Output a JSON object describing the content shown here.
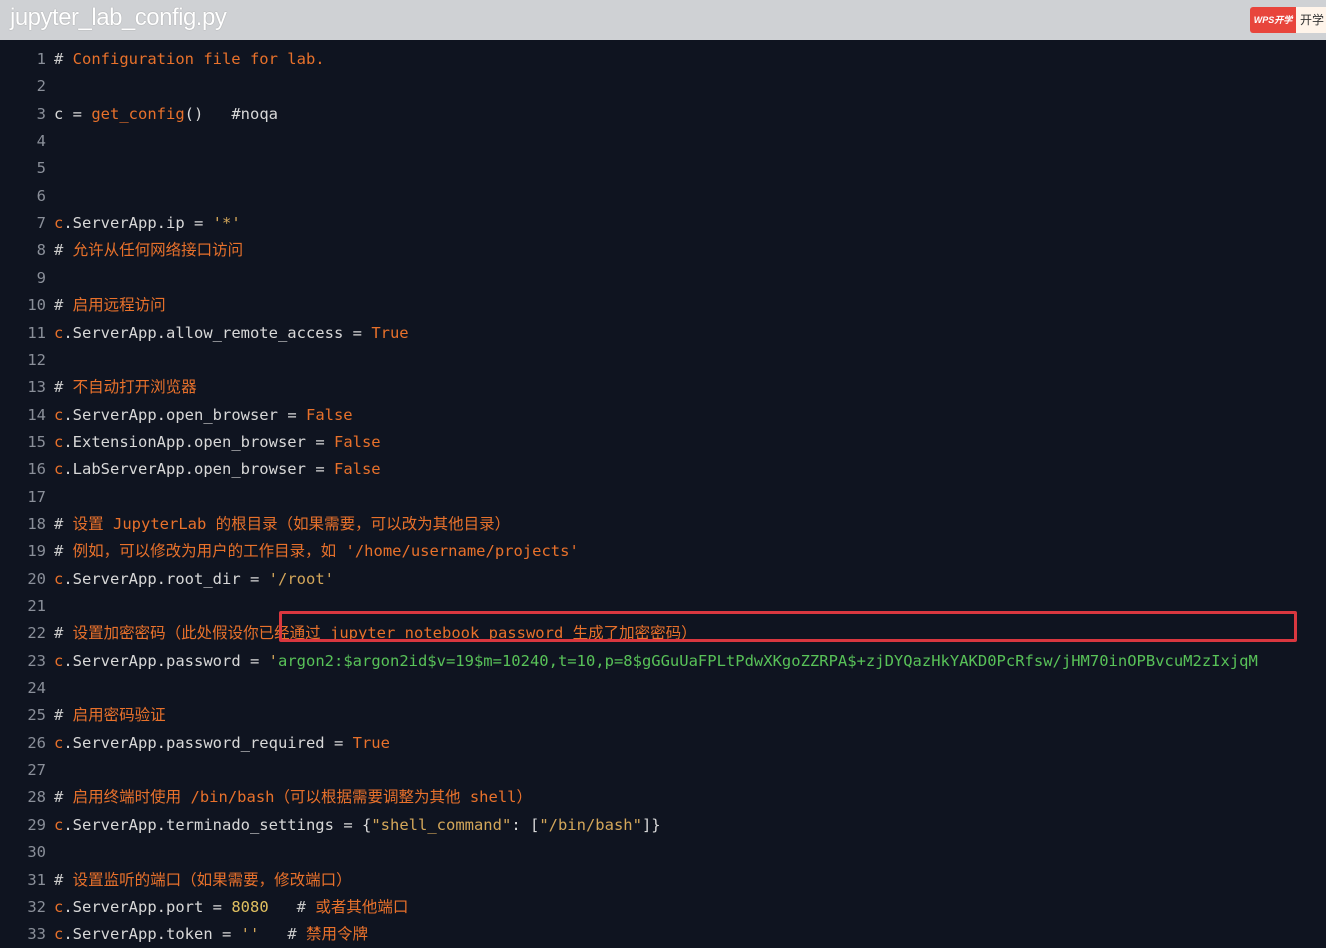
{
  "window": {
    "title": "jupyter_lab_config.py"
  },
  "wps": {
    "badge": "WPS开学季",
    "tab": "开学"
  },
  "lines": [
    {
      "n": "1",
      "parts": [
        [
          "c-hash",
          "# "
        ],
        [
          "c-cmt",
          "Configuration file for lab."
        ]
      ]
    },
    {
      "n": "2",
      "parts": []
    },
    {
      "n": "3",
      "parts": [
        [
          "c-txt",
          "c "
        ],
        [
          "c-op",
          "= "
        ],
        [
          "c-fn",
          "get_config"
        ],
        [
          "c-txt",
          "()   "
        ],
        [
          "c-txt",
          "#noqa"
        ]
      ]
    },
    {
      "n": "4",
      "parts": []
    },
    {
      "n": "5",
      "parts": []
    },
    {
      "n": "6",
      "parts": []
    },
    {
      "n": "7",
      "parts": [
        [
          "c-var",
          "c"
        ],
        [
          "c-txt",
          ".ServerApp.ip "
        ],
        [
          "c-op",
          "= "
        ],
        [
          "c-str",
          "'*'"
        ]
      ]
    },
    {
      "n": "8",
      "parts": [
        [
          "c-hash",
          "# "
        ],
        [
          "c-cmt",
          "允许从任何网络接口访问"
        ]
      ]
    },
    {
      "n": "9",
      "parts": []
    },
    {
      "n": "10",
      "parts": [
        [
          "c-hash",
          "# "
        ],
        [
          "c-cmt",
          "启用远程访问"
        ]
      ]
    },
    {
      "n": "11",
      "parts": [
        [
          "c-var",
          "c"
        ],
        [
          "c-txt",
          ".ServerApp.allow_remote_access "
        ],
        [
          "c-op",
          "= "
        ],
        [
          "c-kw",
          "True"
        ]
      ]
    },
    {
      "n": "12",
      "parts": []
    },
    {
      "n": "13",
      "parts": [
        [
          "c-hash",
          "# "
        ],
        [
          "c-cmt",
          "不自动打开浏览器"
        ]
      ]
    },
    {
      "n": "14",
      "parts": [
        [
          "c-var",
          "c"
        ],
        [
          "c-txt",
          ".ServerApp.open_browser "
        ],
        [
          "c-op",
          "= "
        ],
        [
          "c-kw",
          "False"
        ]
      ]
    },
    {
      "n": "15",
      "parts": [
        [
          "c-var",
          "c"
        ],
        [
          "c-txt",
          ".ExtensionApp.open_browser "
        ],
        [
          "c-op",
          "= "
        ],
        [
          "c-kw",
          "False"
        ]
      ]
    },
    {
      "n": "16",
      "parts": [
        [
          "c-var",
          "c"
        ],
        [
          "c-txt",
          ".LabServerApp.open_browser "
        ],
        [
          "c-op",
          "= "
        ],
        [
          "c-kw",
          "False"
        ]
      ]
    },
    {
      "n": "17",
      "parts": []
    },
    {
      "n": "18",
      "parts": [
        [
          "c-hash",
          "# "
        ],
        [
          "c-cmt",
          "设置 JupyterLab 的根目录（如果需要，可以改为其他目录）"
        ]
      ]
    },
    {
      "n": "19",
      "parts": [
        [
          "c-hash",
          "# "
        ],
        [
          "c-cmt",
          "例如，可以修改为用户的工作目录，如 '/home/username/projects'"
        ]
      ]
    },
    {
      "n": "20",
      "parts": [
        [
          "c-var",
          "c"
        ],
        [
          "c-txt",
          ".ServerApp.root_dir "
        ],
        [
          "c-op",
          "= "
        ],
        [
          "c-str",
          "'/root'"
        ]
      ]
    },
    {
      "n": "21",
      "parts": []
    },
    {
      "n": "22",
      "parts": [
        [
          "c-hash",
          "# "
        ],
        [
          "c-cmt",
          "设置加密密码（此处假设你已经通过 jupyter notebook password 生成了加密密码）"
        ]
      ]
    },
    {
      "n": "23",
      "parts": [
        [
          "c-var",
          "c"
        ],
        [
          "c-txt",
          ".ServerApp.password "
        ],
        [
          "c-op",
          "= "
        ],
        [
          "c-str",
          "'"
        ],
        [
          "c-pw",
          "argon2:$argon2id$v=19$m=10240,t=10,p=8$gGGuUaFPLtPdwXKgoZZRPA$+zjDYQazHkYAKD0PcRfsw/jHM70inOPBvcuM2zIxjqM"
        ]
      ]
    },
    {
      "n": "24",
      "parts": []
    },
    {
      "n": "25",
      "parts": [
        [
          "c-hash",
          "# "
        ],
        [
          "c-cmt",
          "启用密码验证"
        ]
      ]
    },
    {
      "n": "26",
      "parts": [
        [
          "c-var",
          "c"
        ],
        [
          "c-txt",
          ".ServerApp.password_required "
        ],
        [
          "c-op",
          "= "
        ],
        [
          "c-kw",
          "True"
        ]
      ]
    },
    {
      "n": "27",
      "parts": []
    },
    {
      "n": "28",
      "parts": [
        [
          "c-hash",
          "# "
        ],
        [
          "c-cmt",
          "启用终端时使用 /bin/bash（可以根据需要调整为其他 shell）"
        ]
      ]
    },
    {
      "n": "29",
      "parts": [
        [
          "c-var",
          "c"
        ],
        [
          "c-txt",
          ".ServerApp.terminado_settings "
        ],
        [
          "c-op",
          "= "
        ],
        [
          "c-txt",
          "{"
        ],
        [
          "c-str",
          "\"shell_command\""
        ],
        [
          "c-txt",
          ": ["
        ],
        [
          "c-str",
          "\"/bin/bash\""
        ],
        [
          "c-txt",
          "]}"
        ]
      ]
    },
    {
      "n": "30",
      "parts": []
    },
    {
      "n": "31",
      "parts": [
        [
          "c-hash",
          "# "
        ],
        [
          "c-cmt",
          "设置监听的端口（如果需要，修改端口）"
        ]
      ]
    },
    {
      "n": "32",
      "parts": [
        [
          "c-var",
          "c"
        ],
        [
          "c-txt",
          ".ServerApp.port "
        ],
        [
          "c-op",
          "= "
        ],
        [
          "c-num",
          "8080"
        ],
        [
          "c-txt",
          "   "
        ],
        [
          "c-hash",
          "# "
        ],
        [
          "c-cmt",
          "或者其他端口"
        ]
      ]
    },
    {
      "n": "33",
      "parts": [
        [
          "c-var",
          "c"
        ],
        [
          "c-txt",
          ".ServerApp.token "
        ],
        [
          "c-op",
          "= "
        ],
        [
          "c-str",
          "''"
        ],
        [
          "c-txt",
          "   "
        ],
        [
          "c-hash",
          "# "
        ],
        [
          "c-cmt",
          "禁用令牌"
        ]
      ]
    }
  ]
}
